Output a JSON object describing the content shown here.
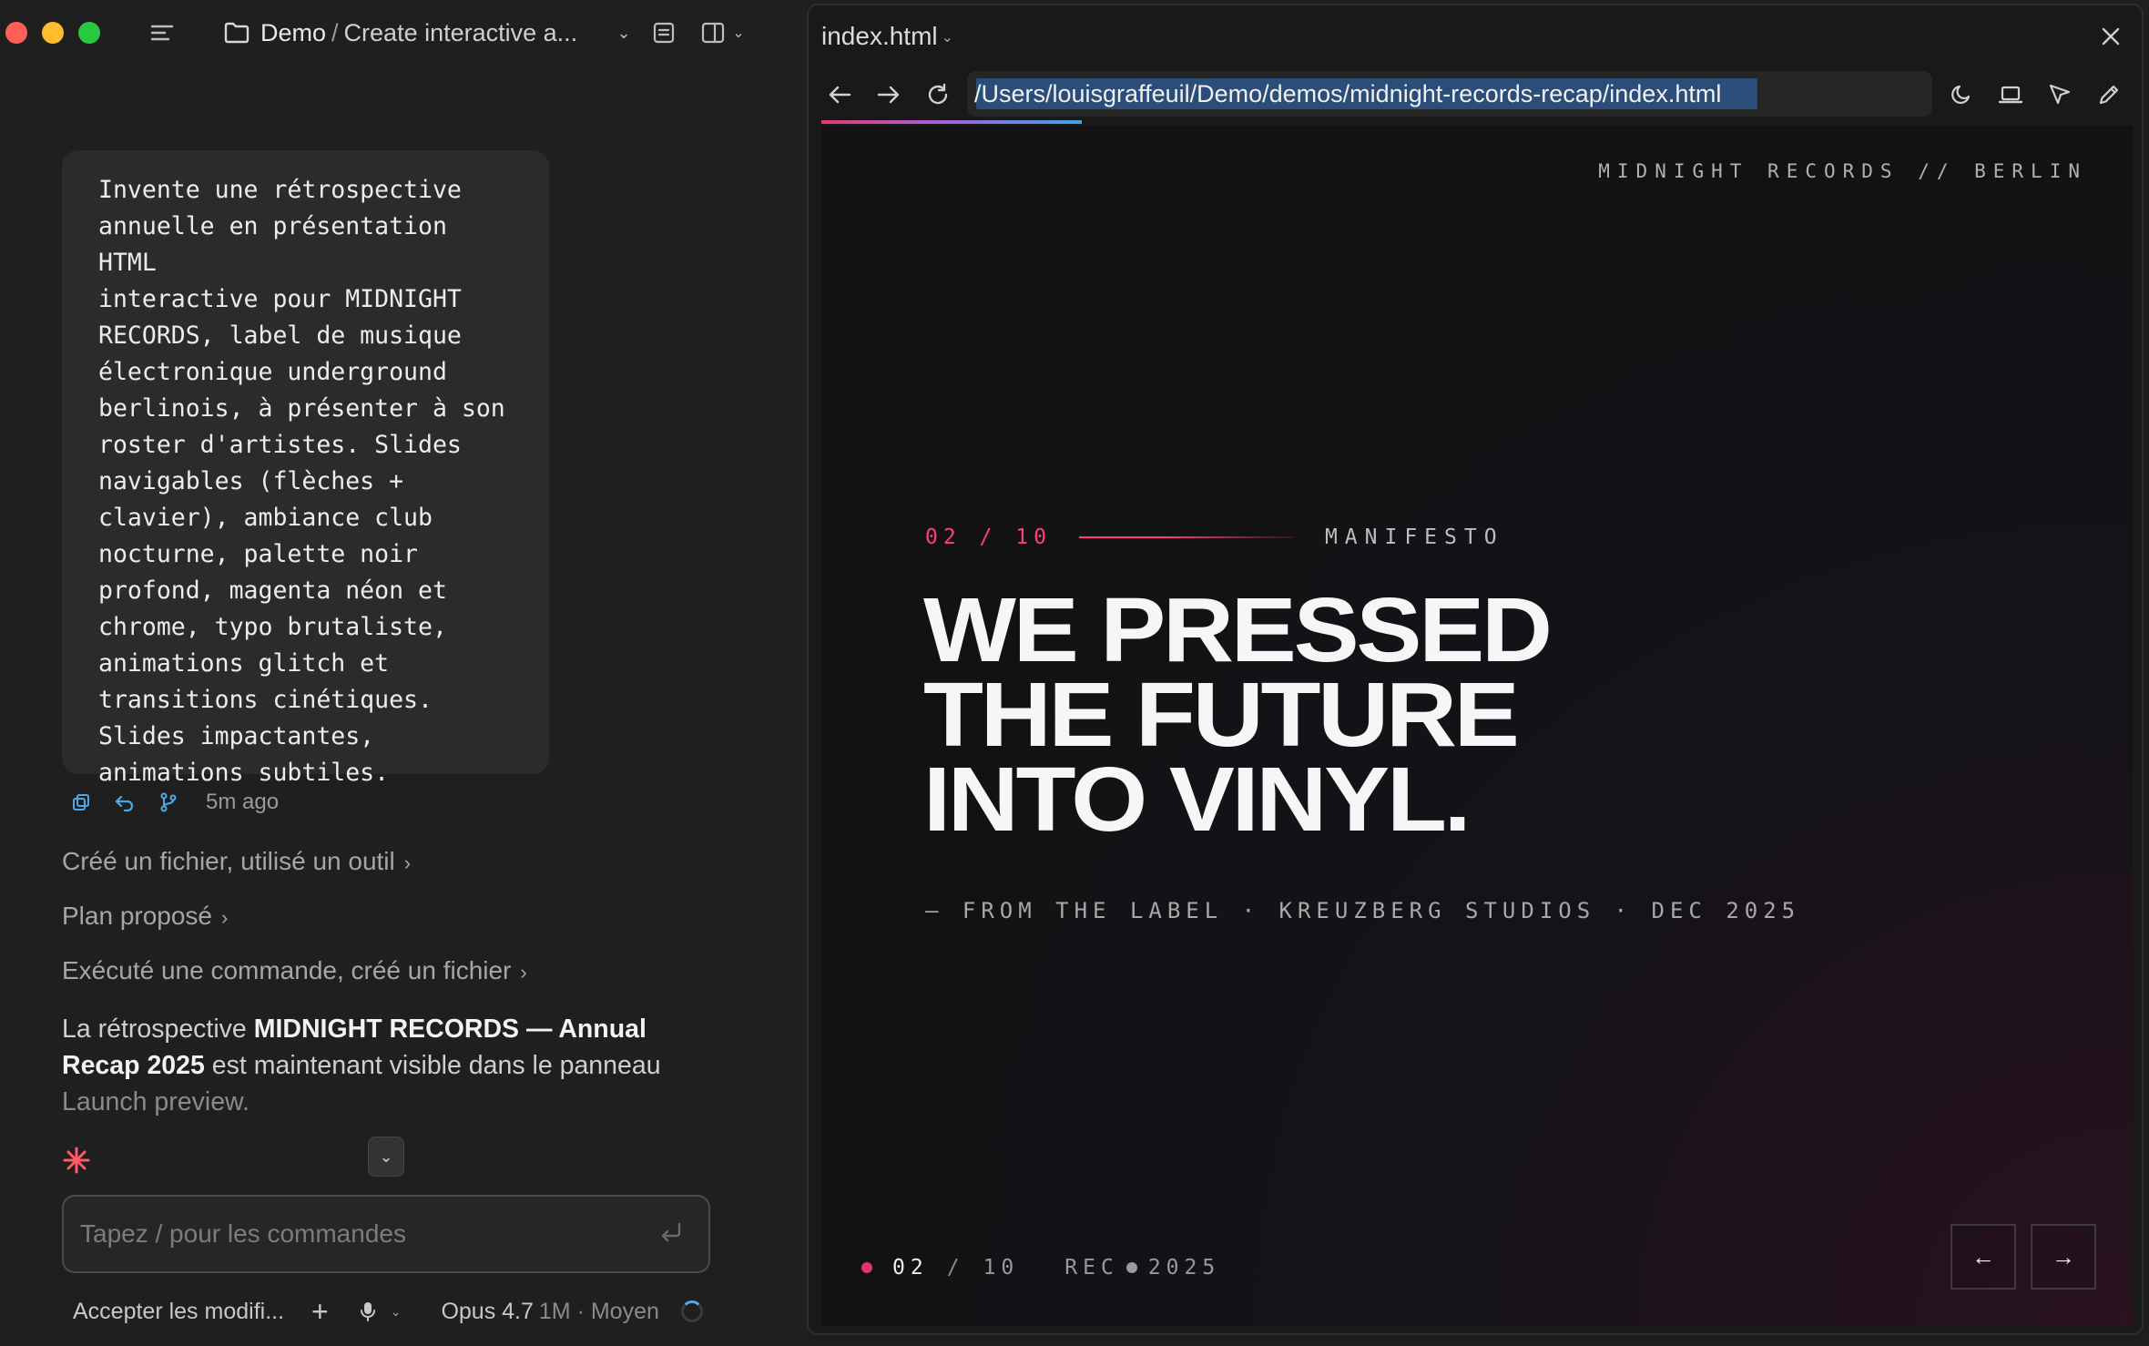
{
  "window": {
    "breadcrumb_root": "Demo",
    "breadcrumb_sep": "/",
    "breadcrumb_title": "Create interactive a..."
  },
  "chat": {
    "prompt": "Invente une rétrospective\nannuelle en présentation HTML\ninteractive pour MIDNIGHT\nRECORDS, label de musique\nélectronique underground\nberlinois, à présenter à son\nroster d'artistes. Slides\nnavigables (flèches +\nclavier), ambiance club\nnocturne, palette noir\nprofond, magenta néon et\nchrome, typo brutaliste,\nanimations glitch et\ntransitions cinétiques.\nSlides impactantes,\nanimations subtiles.",
    "time": "5m ago",
    "activities": [
      "Créé un fichier, utilisé un outil",
      "Plan proposé",
      "Exécuté une commande, créé un fichier"
    ],
    "summary": {
      "p1": "La rétrospective ",
      "b1": "MIDNIGHT RECORDS — Annual Recap 2025",
      "p2": " est maintenant visible dans le panneau ",
      "fade": "Launch preview."
    },
    "composer_placeholder": "Tapez / pour les commandes",
    "accept_label": "Accepter les modifi...",
    "model": "Opus 4.7",
    "model_meta": "1M · Moyen"
  },
  "browser": {
    "tab_title": "index.html",
    "url": "/Users/louisgraffeuil/Demo/demos/midnight-records-recap/index.html"
  },
  "slide": {
    "label": "MIDNIGHT RECORDS // BERLIN",
    "counter": "02 / 10",
    "section": "MANIFESTO",
    "headline": [
      "WE PRESSED",
      "THE FUTURE",
      "INTO VINYL."
    ],
    "byline": "— FROM THE LABEL · KREUZBERG STUDIOS · DEC 2025",
    "footer_current": "02",
    "footer_slash": "/",
    "footer_total": "10",
    "footer_rec": "REC",
    "footer_year": "2025",
    "prev_label": "←",
    "next_label": "→"
  },
  "colors": {
    "accent": "#ff3d7f",
    "link_blue": "#4ea8e8"
  }
}
